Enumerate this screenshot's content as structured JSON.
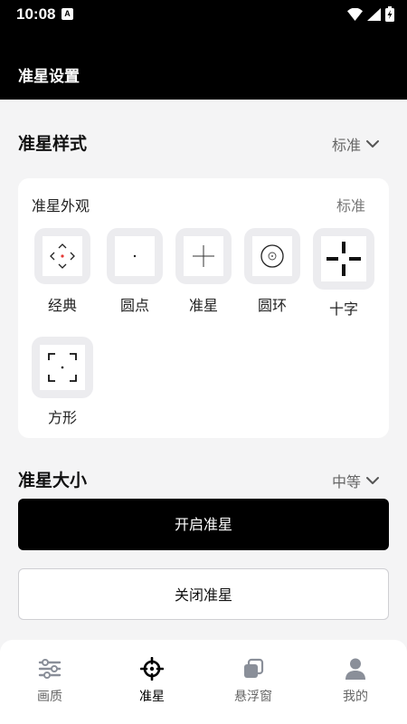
{
  "status_bar": {
    "time": "10:08",
    "notification_glyph": "A",
    "icons": [
      "wifi-icon",
      "signal-icon",
      "battery-charging-icon"
    ]
  },
  "app_bar": {
    "title": "准星设置"
  },
  "crosshair_style": {
    "title": "准星样式",
    "value": "标准",
    "card": {
      "title": "准星外观",
      "value": "标准",
      "options": [
        {
          "label": "经典",
          "icon": "classic-crosshair-icon",
          "accent": "#e53935"
        },
        {
          "label": "圆点",
          "icon": "dot-crosshair-icon"
        },
        {
          "label": "准星",
          "icon": "cross-crosshair-icon"
        },
        {
          "label": "圆环",
          "icon": "ring-crosshair-icon"
        },
        {
          "label": "十字",
          "icon": "plus-crosshair-icon"
        },
        {
          "label": "方形",
          "icon": "square-crosshair-icon"
        }
      ]
    }
  },
  "crosshair_size": {
    "title": "准星大小",
    "value": "中等"
  },
  "buttons": {
    "enable": "开启准星",
    "disable": "关闭准星"
  },
  "bottom_nav": {
    "active_index": 1,
    "items": [
      {
        "label": "画质",
        "icon": "sliders-icon"
      },
      {
        "label": "准星",
        "icon": "crosshair-icon"
      },
      {
        "label": "悬浮窗",
        "icon": "floating-window-icon"
      },
      {
        "label": "我的",
        "icon": "person-icon"
      }
    ]
  },
  "colors": {
    "primary": "#000000",
    "background": "#f4f4f5",
    "inactive": "#8a8f99"
  }
}
